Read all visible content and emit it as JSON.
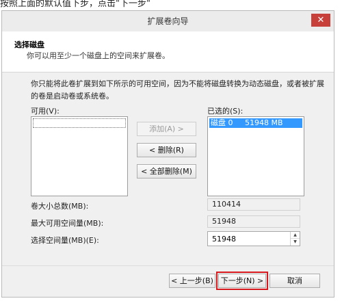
{
  "outer_text": "按照上面的默认值下步，点击\"下一步\"",
  "window": {
    "title": "扩展卷向导",
    "close_glyph": "✕"
  },
  "header": {
    "title": "选择磁盘",
    "subtitle": "你可以用至少一个磁盘上的空间来扩展卷。"
  },
  "description": "你只能将此卷扩展到如下所示的可用空间，因为不能将磁盘转换为动态磁盘，或者被扩展的卷是启动卷或系统卷。",
  "available": {
    "label": "可用(V):",
    "items": []
  },
  "selected": {
    "label": "已选的(S):",
    "items": [
      {
        "disk": "磁盘 0",
        "size": "51948 MB"
      }
    ]
  },
  "buttons": {
    "add": "添加(A) >",
    "remove": "< 删除(R)",
    "remove_all": "< 全部删除(M)"
  },
  "fields": {
    "total_size_label": "卷大小总数(MB):",
    "total_size_value": "110414",
    "max_space_label": "最大可用空间量(MB):",
    "max_space_value": "51948",
    "select_space_label": "选择空间量(MB)(E):",
    "select_space_value": "51948"
  },
  "footer": {
    "back": "< 上一步(B)",
    "next": "下一步(N) >",
    "cancel": "取消"
  },
  "highlight_color": "#d7191e",
  "selection_color": "#3399ff",
  "close_color": "#c7403a"
}
